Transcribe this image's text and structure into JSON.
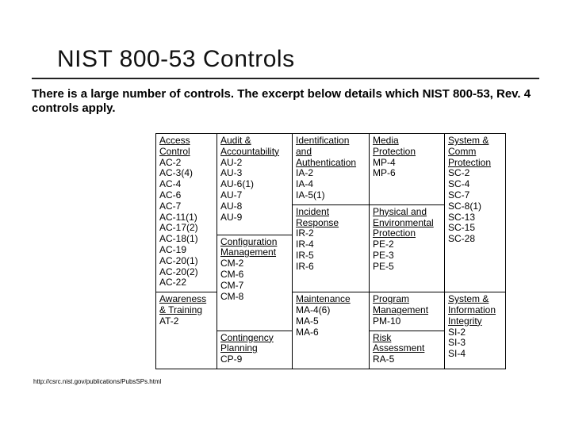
{
  "title": "NIST 800-53 Controls",
  "intro": "There is a large number of controls.  The excerpt below details which NIST 800-53, Rev. 4 controls apply.",
  "footnote": "http://csrc.nist.gov/publications/PubsSPs.html",
  "cells": {
    "c1_1": {
      "heading": "Access Control",
      "items": [
        "AC-2",
        "AC-3(4)",
        "AC-4",
        "AC-6",
        "AC-7",
        "AC-11(1)",
        "AC-17(2)",
        "AC-18(1)",
        "AC-19",
        "AC-20(1)",
        "AC-20(2)",
        "AC-22"
      ]
    },
    "c1_2": {
      "heading": "Awareness & Training",
      "items": [
        "AT-2"
      ]
    },
    "c2_1": {
      "heading": "Audit & Accountability",
      "items": [
        "AU-2",
        "AU-3",
        "AU-6(1)",
        "AU-7",
        "AU-8",
        "AU-9"
      ]
    },
    "c2_2": {
      "heading": "Configuration Management",
      "items": [
        "CM-2",
        "CM-6",
        "CM-7",
        "CM-8"
      ]
    },
    "c2_3": {
      "heading": "Contingency Planning",
      "items": [
        "CP-9"
      ]
    },
    "c3_1": {
      "heading": "Identification and Authentication",
      "items": [
        "IA-2",
        "IA-4",
        "IA-5(1)"
      ]
    },
    "c3_2": {
      "heading": "Incident Response",
      "items": [
        "IR-2",
        "IR-4",
        "IR-5",
        "IR-6"
      ]
    },
    "c3_3": {
      "heading": "Maintenance",
      "items": [
        "MA-4(6)",
        "MA-5",
        "MA-6"
      ]
    },
    "c4_1": {
      "heading": "Media Protection",
      "items": [
        "MP-4",
        "MP-6"
      ]
    },
    "c4_2": {
      "heading": "Physical and Environmental Protection",
      "items": [
        "PE-2",
        "PE-3",
        "PE-5"
      ]
    },
    "c4_3": {
      "heading": "Program Management",
      "items": [
        "PM-10"
      ]
    },
    "c4_4": {
      "heading": "Risk Assessment",
      "items": [
        "RA-5"
      ]
    },
    "c5_1": {
      "heading": "System & Comm Protection",
      "items": [
        "SC-2",
        "SC-4",
        "SC-7",
        "SC-8(1)",
        "SC-13",
        "SC-15",
        "SC-28"
      ]
    },
    "c5_2": {
      "heading": "System & Information Integrity",
      "items": [
        "SI-2",
        "SI-3",
        "SI-4"
      ]
    }
  }
}
